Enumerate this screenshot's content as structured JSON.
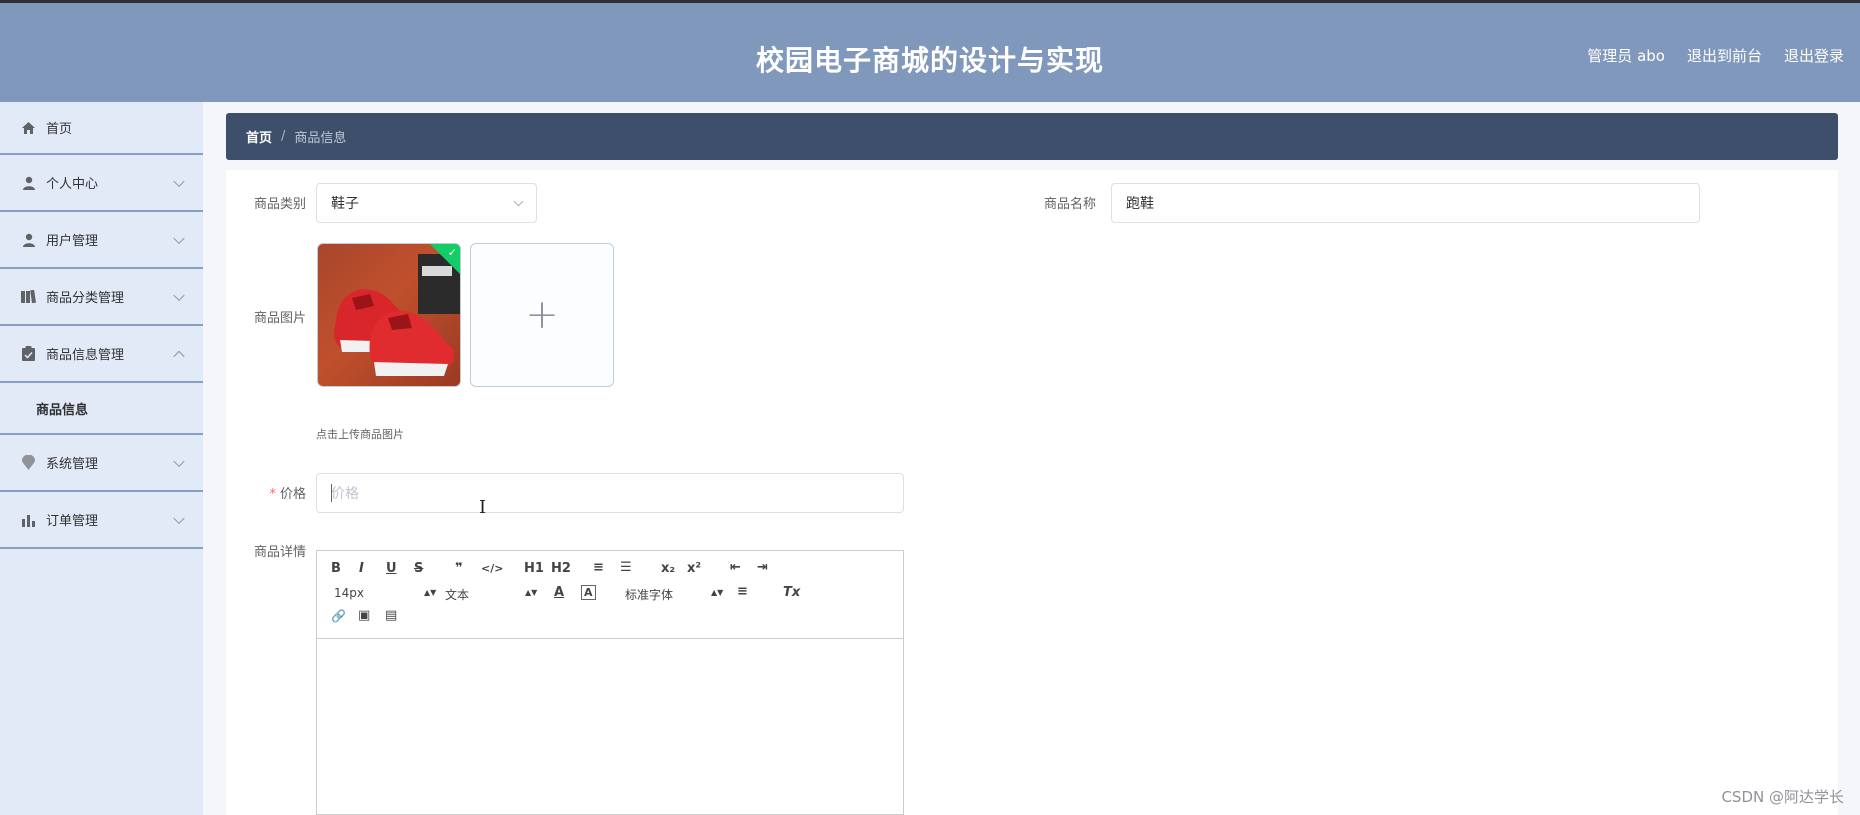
{
  "header": {
    "title": "校园电子商城的设计与实现",
    "links": [
      "管理员 abo",
      "退出到前台",
      "退出登录"
    ]
  },
  "sidebar": {
    "items": [
      {
        "label": "首页",
        "icon": "home-icon",
        "has_arrow": false
      },
      {
        "label": "个人中心",
        "icon": "user-icon",
        "has_arrow": true
      },
      {
        "label": "用户管理",
        "icon": "user-icon",
        "has_arrow": true
      },
      {
        "label": "商品分类管理",
        "icon": "category-icon",
        "has_arrow": true
      },
      {
        "label": "商品信息管理",
        "icon": "clipboard-icon",
        "has_arrow": true,
        "expanded": true,
        "sub": "商品信息"
      },
      {
        "label": "系统管理",
        "icon": "location-icon",
        "has_arrow": true
      },
      {
        "label": "订单管理",
        "icon": "bar-chart-icon",
        "has_arrow": true
      }
    ]
  },
  "breadcrumb": {
    "home": "首页",
    "separator": "/",
    "current": "商品信息"
  },
  "form": {
    "category_label": "商品类别",
    "category_value": "鞋子",
    "name_label": "商品名称",
    "name_value": "跑鞋",
    "image_label": "商品图片",
    "image_hint": "点击上传商品图片",
    "upload_plus": "+",
    "price_required": "*",
    "price_label": "价格",
    "price_placeholder": "价格",
    "detail_label": "商品详情"
  },
  "editor": {
    "buttons": [
      "B",
      "I",
      "U",
      "S",
      "❞",
      "</>",
      "H1",
      "H2",
      "≡",
      "☰",
      "x₂",
      "x²",
      "⇤",
      "⇥"
    ],
    "size_select": "14px",
    "header_select": "文本",
    "font_select": "标准字体",
    "row2_buttons": [
      "A",
      "A",
      "≡",
      "Tx"
    ],
    "row3_buttons": [
      "🔗",
      "▣",
      "▤"
    ]
  },
  "watermark": "CSDN @阿达学长",
  "colors": {
    "header_bg": "#8198bd",
    "sidebar_bg": "#e3eaf7",
    "breadcrumb_bg": "#3e4f6b",
    "check": "#13ce66"
  }
}
